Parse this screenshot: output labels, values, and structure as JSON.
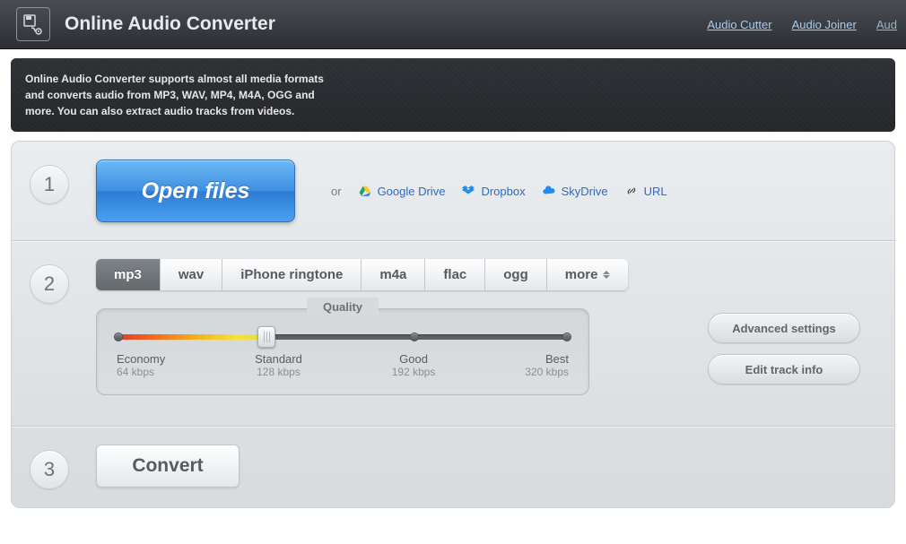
{
  "header": {
    "title": "Online Audio Converter",
    "links": [
      "Audio Cutter",
      "Audio Joiner",
      "Aud"
    ]
  },
  "description": "Online Audio Converter supports almost all media formats and converts audio from MP3, WAV, MP4, M4A, OGG and more. You can also extract audio tracks from videos.",
  "step1": {
    "open": "Open files",
    "or": "or",
    "sources": {
      "gdrive": "Google Drive",
      "dropbox": "Dropbox",
      "skydrive": "SkyDrive",
      "url": "URL"
    }
  },
  "step2": {
    "tabs": [
      "mp3",
      "wav",
      "iPhone ringtone",
      "m4a",
      "flac",
      "ogg",
      "more"
    ],
    "active_tab": 0,
    "quality_label": "Quality",
    "quality_levels": [
      {
        "name": "Economy",
        "bitrate": "64 kbps"
      },
      {
        "name": "Standard",
        "bitrate": "128 kbps"
      },
      {
        "name": "Good",
        "bitrate": "192 kbps"
      },
      {
        "name": "Best",
        "bitrate": "320 kbps"
      }
    ],
    "selected_level_index": 1,
    "advanced": "Advanced settings",
    "trackinfo": "Edit track info"
  },
  "step3": {
    "convert": "Convert"
  }
}
